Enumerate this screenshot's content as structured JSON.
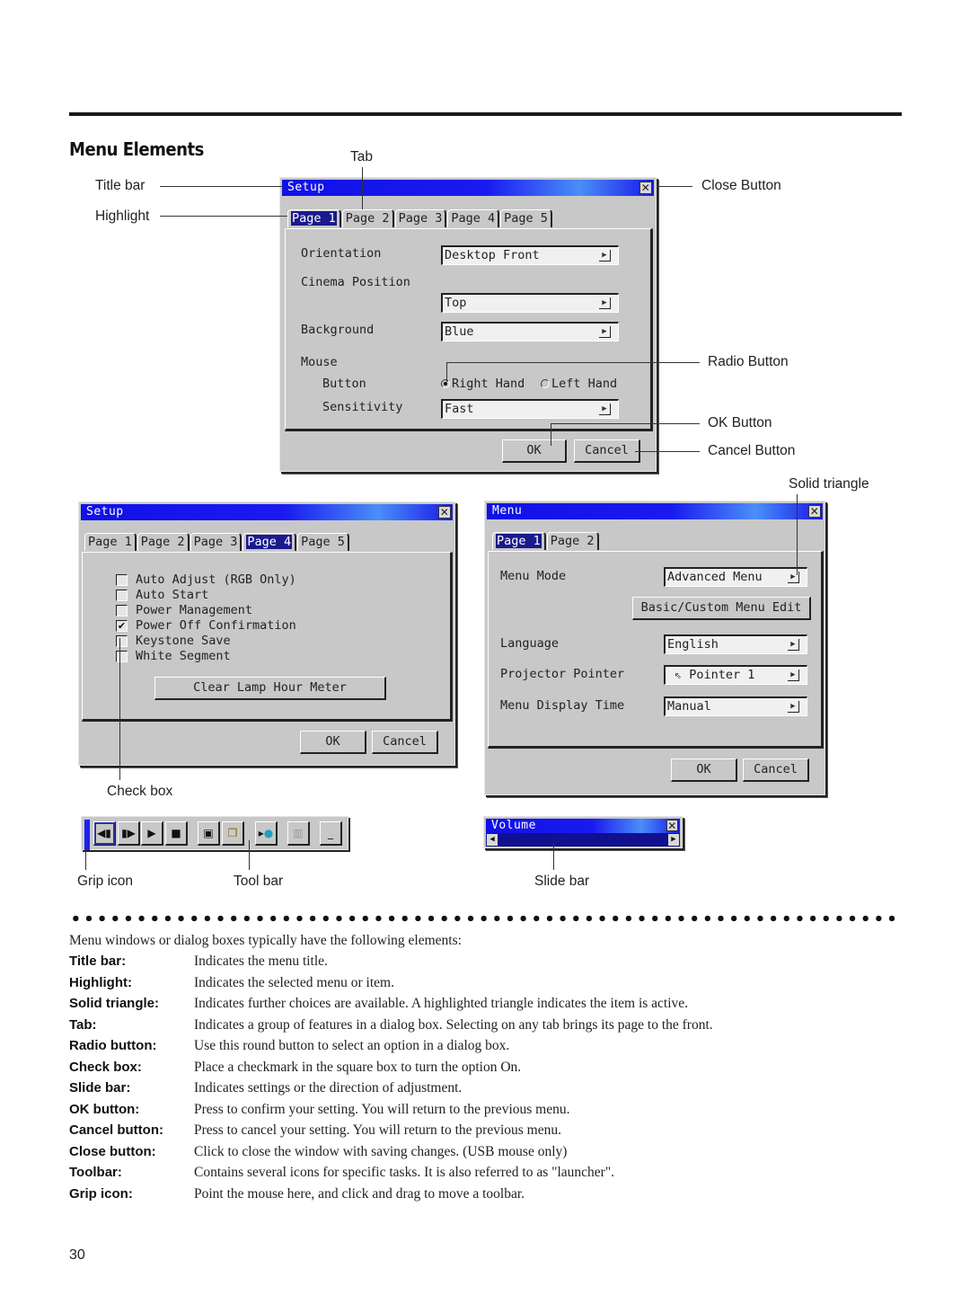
{
  "section_title": "Menu Elements",
  "callouts": {
    "tab": "Tab",
    "title_bar": "Title bar",
    "highlight": "Highlight",
    "close_button": "Close Button",
    "radio_button": "Radio Button",
    "ok_button": "OK Button",
    "cancel_button": "Cancel Button",
    "solid_triangle": "Solid triangle",
    "check_box": "Check box",
    "grip_icon": "Grip icon",
    "tool_bar": "Tool bar",
    "slide_bar": "Slide bar"
  },
  "setup_page1": {
    "title": "Setup",
    "tabs": [
      "Page 1",
      "Page 2",
      "Page 3",
      "Page 4",
      "Page 5"
    ],
    "active_tab": 0,
    "rows": {
      "orientation_label": "Orientation",
      "orientation_value": "Desktop Front",
      "cinema_label": "Cinema Position",
      "cinema_value": "Top",
      "background_label": "Background",
      "background_value": "Blue",
      "mouse_label": "Mouse",
      "button_label": "Button",
      "radio_right": "Right Hand",
      "radio_left": "Left Hand",
      "radio_selected": "Right Hand",
      "sensitivity_label": "Sensitivity",
      "sensitivity_value": "Fast"
    },
    "ok": "OK",
    "cancel": "Cancel"
  },
  "setup_page4": {
    "title": "Setup",
    "tabs": [
      "Page 1",
      "Page 2",
      "Page 3",
      "Page 4",
      "Page 5"
    ],
    "active_tab": 3,
    "checkboxes": [
      {
        "label": "Auto Adjust (RGB Only)",
        "checked": false
      },
      {
        "label": "Auto Start",
        "checked": false
      },
      {
        "label": "Power Management",
        "checked": false
      },
      {
        "label": "Power Off Confirmation",
        "checked": true
      },
      {
        "label": "Keystone Save",
        "checked": false
      },
      {
        "label": "White Segment",
        "checked": false
      }
    ],
    "clear_lamp": "Clear Lamp Hour Meter",
    "ok": "OK",
    "cancel": "Cancel"
  },
  "menu_window": {
    "title": "Menu",
    "tabs": [
      "Page 1",
      "Page 2"
    ],
    "active_tab": 0,
    "menu_mode_label": "Menu Mode",
    "menu_mode_value": "Advanced Menu",
    "basic_custom_button": "Basic/Custom Menu Edit",
    "language_label": "Language",
    "language_value": "English",
    "pointer_label": "Projector Pointer",
    "pointer_value": "Pointer 1",
    "display_time_label": "Menu Display Time",
    "display_time_value": "Manual",
    "ok": "OK",
    "cancel": "Cancel"
  },
  "toolbar": {
    "icons": [
      "rewind-icon",
      "forward-icon",
      "play-icon",
      "stop-icon",
      "window-icon",
      "folder-window-icon",
      "pointer-icon",
      "trash-icon",
      "minimize-icon"
    ]
  },
  "volume_window": {
    "title": "Volume"
  },
  "intro": "Menu windows or dialog boxes typically have the following elements:",
  "definitions": [
    {
      "term": "Title bar:",
      "desc": "Indicates the menu title."
    },
    {
      "term": "Highlight:",
      "desc": "Indicates the selected menu or item."
    },
    {
      "term": "Solid triangle:",
      "desc": "Indicates further choices are available. A highlighted triangle indicates the item is active."
    },
    {
      "term": "Tab:",
      "desc": "Indicates a group of features in a dialog box. Selecting on any tab brings its page to the front."
    },
    {
      "term": "Radio button:",
      "desc": "Use this round button to select an option in a dialog box."
    },
    {
      "term": "Check box:",
      "desc": "Place a checkmark in the square box to turn the option On."
    },
    {
      "term": "Slide bar:",
      "desc": "Indicates settings or the direction of adjustment."
    },
    {
      "term": "OK button:",
      "desc": "Press to confirm your setting. You will return to the previous menu."
    },
    {
      "term": "Cancel button:",
      "desc": "Press to cancel your setting. You will return to the previous menu."
    },
    {
      "term": "Close button:",
      "desc": "Click to close the window with saving changes. (USB mouse only)"
    },
    {
      "term": "Toolbar:",
      "desc": "Contains several icons for specific tasks. It is also referred to as \"launcher\"."
    },
    {
      "term": "Grip icon:",
      "desc": "Point the mouse here, and click and drag to move a toolbar."
    }
  ],
  "page_number": "30"
}
